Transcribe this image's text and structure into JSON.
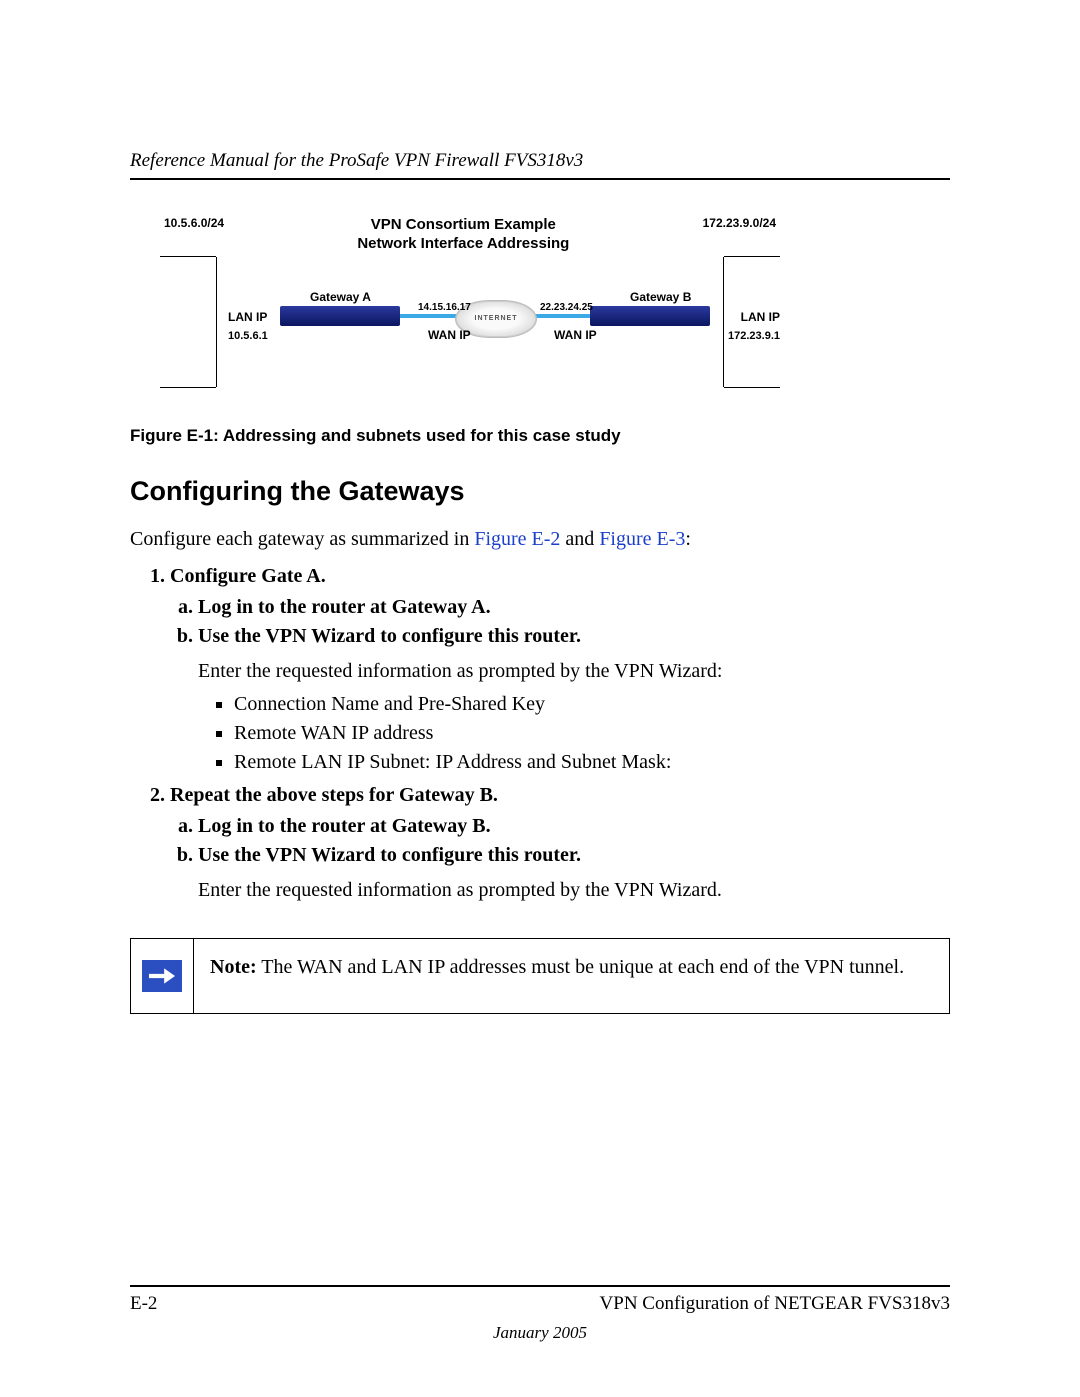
{
  "header": "Reference Manual for the ProSafe VPN Firewall FVS318v3",
  "diagram": {
    "title_line1": "VPN Consortium Example",
    "title_line2": "Network Interface Addressing",
    "subnet_a": "10.5.6.0/24",
    "subnet_b": "172.23.9.0/24",
    "gateway_a_label": "Gateway A",
    "gateway_b_label": "Gateway B",
    "lan_ip_label": "LAN IP",
    "lan_ip_a": "10.5.6.1",
    "lan_ip_b": "172.23.9.1",
    "wan_ip_label": "WAN IP",
    "wan_ip_a": "14.15.16.17",
    "wan_ip_b": "22.23.24.25",
    "cloud": "INTERNET"
  },
  "figure_caption": "Figure E-1:  Addressing and subnets used for this case study",
  "section_heading": "Configuring the Gateways",
  "intro_pre": "Configure each gateway as summarized in ",
  "intro_link1": "Figure E-2",
  "intro_mid": " and ",
  "intro_link2": "Figure E-3",
  "intro_post": ":",
  "steps": {
    "s1": "Configure Gate A.",
    "s1a": "Log in to the router at Gateway A.",
    "s1b": "Use the VPN Wizard to configure this router.",
    "s1b_desc": "Enter the requested information as prompted by the VPN Wizard:",
    "bullets": [
      "Connection Name and Pre-Shared Key",
      "Remote WAN IP address",
      "Remote LAN IP Subnet: IP Address and Subnet Mask:"
    ],
    "s2": "Repeat the above steps for Gateway B.",
    "s2a": "Log in to the router at Gateway B.",
    "s2b": "Use the VPN Wizard to configure this router.",
    "s2b_desc": "Enter the requested information as prompted by the VPN Wizard."
  },
  "note_label": "Note:",
  "note_text": " The WAN and LAN IP addresses must be unique at each end of the VPN tunnel.",
  "footer": {
    "page": "E-2",
    "right": "VPN Configuration of NETGEAR FVS318v3",
    "date": "January 2005"
  }
}
